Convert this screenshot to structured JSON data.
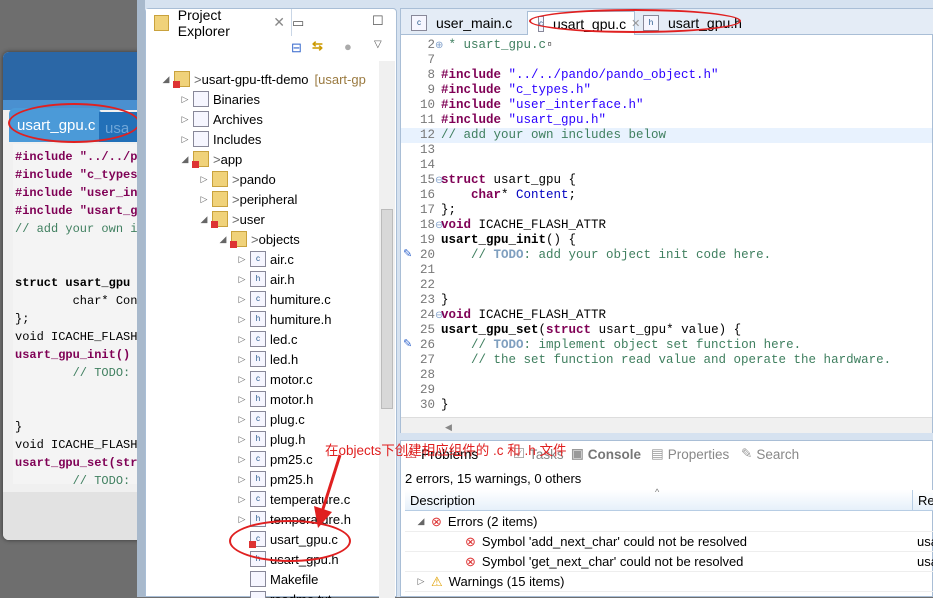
{
  "background_editor": {
    "tabs": [
      "usart_gpu.c",
      "usa"
    ],
    "lines": [
      {
        "t": "#include \"../../p",
        "c": "kw"
      },
      {
        "t": "#include \"c_types",
        "c": "kw"
      },
      {
        "t": "#include \"user_in",
        "c": "kw"
      },
      {
        "t": "#include \"usart_g",
        "c": "kw"
      },
      {
        "t": "// add your own i",
        "c": "cm"
      },
      {
        "t": "",
        "c": ""
      },
      {
        "t": "",
        "c": ""
      },
      {
        "t": "struct usart_gpu",
        "c": "bold"
      },
      {
        "t": "        char* Con",
        "c": ""
      },
      {
        "t": "};",
        "c": ""
      },
      {
        "t": "void ICACHE_FLASH",
        "c": ""
      },
      {
        "t": "usart_gpu_init()",
        "c": "kw"
      },
      {
        "t": "        // TODO:",
        "c": "cm"
      },
      {
        "t": "",
        "c": ""
      },
      {
        "t": "",
        "c": ""
      },
      {
        "t": "}",
        "c": ""
      },
      {
        "t": "void ICACHE_FLASH",
        "c": ""
      },
      {
        "t": "usart_gpu_set(str",
        "c": "kw"
      },
      {
        "t": "        // TODO:",
        "c": "cm"
      }
    ]
  },
  "project_explorer": {
    "title": "Project Explorer",
    "tree": [
      {
        "label": "usart-gpu-tft-demo",
        "suffix": "[usart-gp",
        "depth": 0,
        "tw": "◢",
        "icon": "project",
        "err": true,
        "pre": "> "
      },
      {
        "label": "Binaries",
        "depth": 1,
        "tw": "▷",
        "icon": "binaries"
      },
      {
        "label": "Archives",
        "depth": 1,
        "tw": "▷",
        "icon": "archives"
      },
      {
        "label": "Includes",
        "depth": 1,
        "tw": "▷",
        "icon": "includes"
      },
      {
        "label": "app",
        "depth": 1,
        "tw": "◢",
        "icon": "folder",
        "err": true,
        "pre": "> "
      },
      {
        "label": "pando",
        "depth": 2,
        "tw": "▷",
        "icon": "folder",
        "pre": "> "
      },
      {
        "label": "peripheral",
        "depth": 2,
        "tw": "▷",
        "icon": "folder",
        "pre": "> "
      },
      {
        "label": "user",
        "depth": 2,
        "tw": "◢",
        "icon": "folder",
        "err": true,
        "pre": "> "
      },
      {
        "label": "objects",
        "depth": 3,
        "tw": "◢",
        "icon": "folder",
        "err": true,
        "pre": "> "
      },
      {
        "label": "air.c",
        "depth": 4,
        "tw": "▷",
        "icon": "c-file"
      },
      {
        "label": "air.h",
        "depth": 4,
        "tw": "▷",
        "icon": "h-file"
      },
      {
        "label": "humiture.c",
        "depth": 4,
        "tw": "▷",
        "icon": "c-file"
      },
      {
        "label": "humiture.h",
        "depth": 4,
        "tw": "▷",
        "icon": "h-file"
      },
      {
        "label": "led.c",
        "depth": 4,
        "tw": "▷",
        "icon": "c-file"
      },
      {
        "label": "led.h",
        "depth": 4,
        "tw": "▷",
        "icon": "h-file"
      },
      {
        "label": "motor.c",
        "depth": 4,
        "tw": "▷",
        "icon": "c-file"
      },
      {
        "label": "motor.h",
        "depth": 4,
        "tw": "▷",
        "icon": "h-file"
      },
      {
        "label": "plug.c",
        "depth": 4,
        "tw": "▷",
        "icon": "c-file"
      },
      {
        "label": "plug.h",
        "depth": 4,
        "tw": "▷",
        "icon": "h-file"
      },
      {
        "label": "pm25.c",
        "depth": 4,
        "tw": "▷",
        "icon": "c-file"
      },
      {
        "label": "pm25.h",
        "depth": 4,
        "tw": "▷",
        "icon": "h-file"
      },
      {
        "label": "temperature.c",
        "depth": 4,
        "tw": "▷",
        "icon": "c-file"
      },
      {
        "label": "temperature.h",
        "depth": 4,
        "tw": "▷",
        "icon": "h-file"
      },
      {
        "label": "usart_gpu.c",
        "depth": 4,
        "tw": "",
        "icon": "c-file",
        "err": true
      },
      {
        "label": "usart_gpu.h",
        "depth": 4,
        "tw": "",
        "icon": "h-file"
      },
      {
        "label": "Makefile",
        "depth": 4,
        "tw": "",
        "icon": "makefile"
      },
      {
        "label": "readme.txt",
        "depth": 4,
        "tw": "",
        "icon": "text-file"
      }
    ]
  },
  "annotation": {
    "text": "在objects下创建相应组件的 .c 和 .h 文件",
    "color": "#e02020"
  },
  "editor": {
    "tabs": [
      {
        "label": "user_main.c",
        "icon": "c-file"
      },
      {
        "label": "usart_gpu.c",
        "icon": "c-file",
        "active": true
      },
      {
        "label": "usart_gpu.h",
        "icon": "h-file"
      }
    ],
    "lines": [
      {
        "n": "2",
        "m": "⊕",
        "s": [
          {
            "t": " * usart_gpu.c",
            "c": "cm"
          },
          {
            "t": "▫",
            "c": ""
          }
        ]
      },
      {
        "n": "7",
        "s": []
      },
      {
        "n": "8",
        "s": [
          {
            "t": "#include ",
            "c": "kw"
          },
          {
            "t": "\"../../pando/pando_object.h\"",
            "c": "str"
          }
        ]
      },
      {
        "n": "9",
        "s": [
          {
            "t": "#include ",
            "c": "kw"
          },
          {
            "t": "\"c_types.h\"",
            "c": "str"
          }
        ]
      },
      {
        "n": "10",
        "s": [
          {
            "t": "#include ",
            "c": "kw"
          },
          {
            "t": "\"user_interface.h\"",
            "c": "str"
          }
        ]
      },
      {
        "n": "11",
        "s": [
          {
            "t": "#include ",
            "c": "kw"
          },
          {
            "t": "\"usart_gpu.h\"",
            "c": "str"
          }
        ]
      },
      {
        "n": "12",
        "s": [
          {
            "t": "// add your own includes below",
            "c": "cm"
          }
        ],
        "hl": true
      },
      {
        "n": "13",
        "s": []
      },
      {
        "n": "14",
        "s": []
      },
      {
        "n": "15",
        "m": "⊖",
        "s": [
          {
            "t": "struct ",
            "c": "kw"
          },
          {
            "t": "usart_gpu {",
            "c": ""
          }
        ]
      },
      {
        "n": "16",
        "s": [
          {
            "t": "    char",
            "c": "kw"
          },
          {
            "t": "* ",
            "c": ""
          },
          {
            "t": "Content",
            "c": "fd"
          },
          {
            "t": ";",
            "c": ""
          }
        ]
      },
      {
        "n": "17",
        "s": [
          {
            "t": "};",
            "c": ""
          }
        ]
      },
      {
        "n": "18",
        "m": "⊖",
        "s": [
          {
            "t": "void ",
            "c": "kw"
          },
          {
            "t": "ICACHE_FLASH_ATTR",
            "c": ""
          }
        ]
      },
      {
        "n": "19",
        "s": [
          {
            "t": "usart_gpu_init",
            "c": "bold"
          },
          {
            "t": "() {",
            "c": ""
          }
        ]
      },
      {
        "n": "20",
        "task": true,
        "s": [
          {
            "t": "    // ",
            "c": "cm"
          },
          {
            "t": "TODO",
            "c": "todo"
          },
          {
            "t": ": add your object init code here.",
            "c": "cm"
          }
        ]
      },
      {
        "n": "21",
        "s": []
      },
      {
        "n": "22",
        "s": []
      },
      {
        "n": "23",
        "s": [
          {
            "t": "}",
            "c": ""
          }
        ]
      },
      {
        "n": "24",
        "m": "⊖",
        "s": [
          {
            "t": "void ",
            "c": "kw"
          },
          {
            "t": "ICACHE_FLASH_ATTR",
            "c": ""
          }
        ]
      },
      {
        "n": "25",
        "s": [
          {
            "t": "usart_gpu_set",
            "c": "bold"
          },
          {
            "t": "(",
            "c": ""
          },
          {
            "t": "struct ",
            "c": "kw"
          },
          {
            "t": "usart_gpu* value) {",
            "c": ""
          }
        ]
      },
      {
        "n": "26",
        "task": true,
        "s": [
          {
            "t": "    // ",
            "c": "cm"
          },
          {
            "t": "TODO",
            "c": "todo"
          },
          {
            "t": ": implement object set function here.",
            "c": "cm"
          }
        ]
      },
      {
        "n": "27",
        "s": [
          {
            "t": "    // the set function read value and operate the hardware.",
            "c": "cm"
          }
        ]
      },
      {
        "n": "28",
        "s": []
      },
      {
        "n": "29",
        "s": []
      },
      {
        "n": "30",
        "s": [
          {
            "t": "}",
            "c": ""
          }
        ]
      }
    ]
  },
  "problems": {
    "tabs": [
      "Problems",
      "Tasks",
      "Console",
      "Properties",
      "Search"
    ],
    "summary": "2 errors, 15 warnings, 0 others",
    "columns": [
      "Description",
      "Re"
    ],
    "rows": [
      {
        "label": "Errors (2 items)",
        "type": "error-group",
        "tw": "◢"
      },
      {
        "label": "Symbol 'add_next_char' could not be resolved",
        "type": "error",
        "res": "usa"
      },
      {
        "label": "Symbol 'get_next_char' could not be resolved",
        "type": "error",
        "res": "usa"
      },
      {
        "label": "Warnings (15 items)",
        "type": "warning-group",
        "tw": "▷"
      }
    ]
  }
}
